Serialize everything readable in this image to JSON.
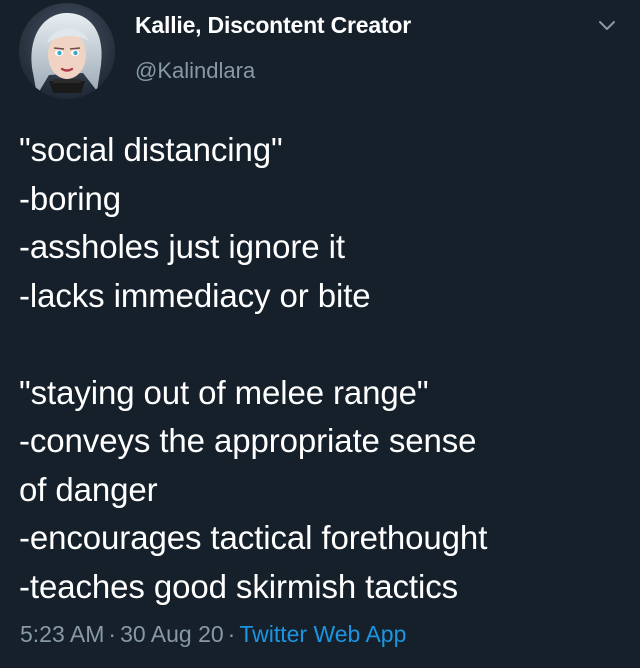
{
  "author": {
    "display_name": "Kallie, Discontent Creator",
    "handle": "@Kalindlara"
  },
  "icons": {
    "avatar": "avatar-portrait",
    "menu": "chevron-down-icon"
  },
  "tweet": {
    "lines": [
      "\"social distancing\"",
      "-boring",
      "-assholes just ignore it",
      "-lacks immediacy or bite",
      "",
      "\"staying out of melee range\"",
      "-conveys the appropriate sense",
      "of danger",
      "-encourages tactical forethought",
      "-teaches good skirmish tactics"
    ]
  },
  "meta": {
    "time": "5:23 AM",
    "separator": "·",
    "date": "30 Aug 20",
    "source": "Twitter Web App"
  },
  "colors": {
    "background": "#15202b",
    "text": "#ffffff",
    "secondary": "#8899a6",
    "link": "#1b95e0"
  }
}
